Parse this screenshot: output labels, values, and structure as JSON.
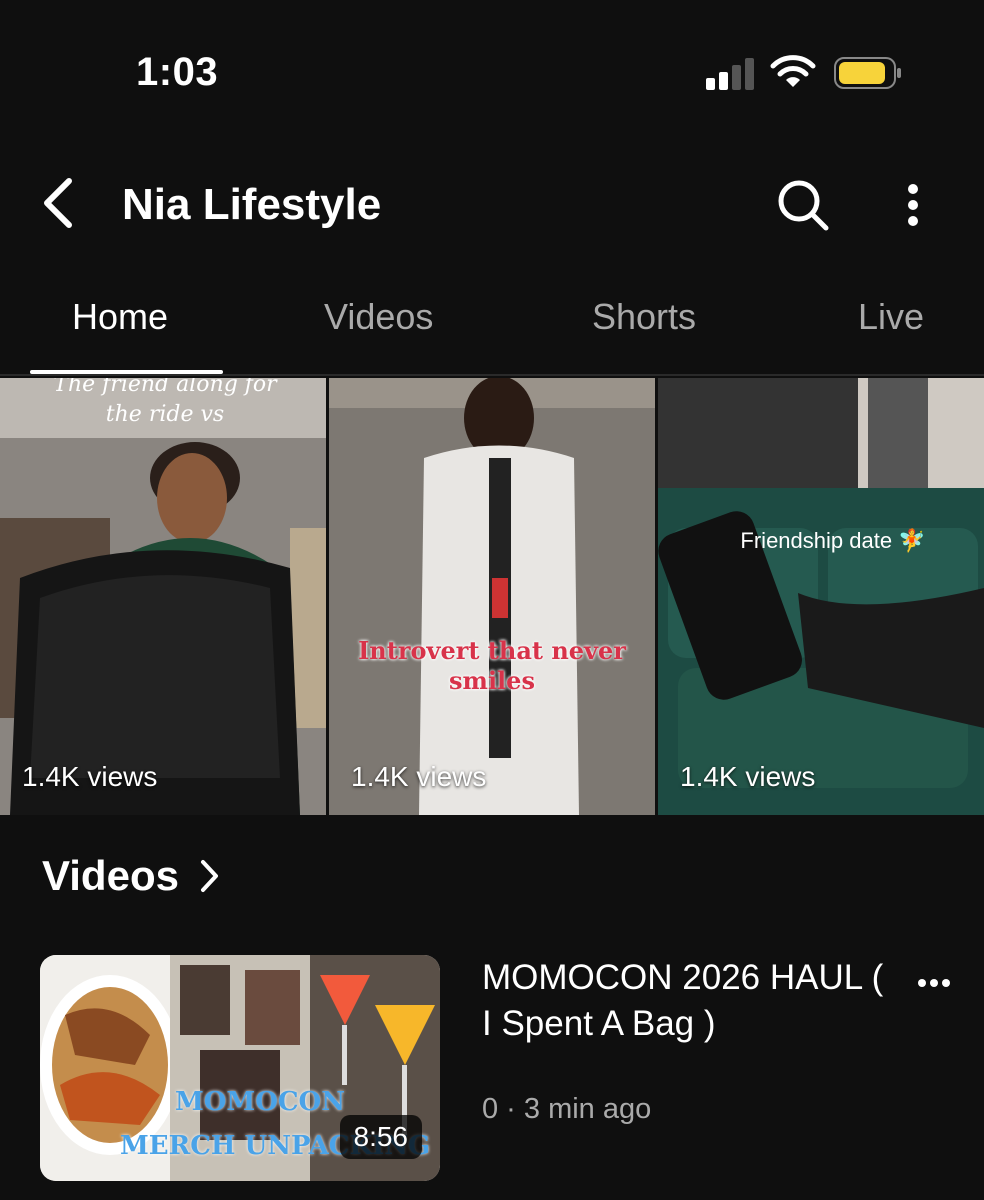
{
  "status_bar": {
    "time": "1:03"
  },
  "header": {
    "title": "Nia Lifestyle"
  },
  "tabs": [
    {
      "label": "Home",
      "active": true
    },
    {
      "label": "Videos",
      "active": false
    },
    {
      "label": "Shorts",
      "active": false
    },
    {
      "label": "Live",
      "active": false
    }
  ],
  "shorts": [
    {
      "views": "1.4K views",
      "overlay": "The friend along for the ride vs"
    },
    {
      "views": "1.4K views",
      "overlay": "Introvert that never smiles"
    },
    {
      "views": "1.4K views",
      "overlay": "Friendship date 🧚"
    }
  ],
  "videos_section": {
    "title": "Videos"
  },
  "video": {
    "title": "MOMOCON 2026 HAUL ( I Spent A Bag )",
    "meta": "0 · 3 min ago",
    "duration": "8:56",
    "thumb_text_1": "MOMOCON",
    "thumb_text_2": "MERCH UNPACKING"
  },
  "colors": {
    "background": "#0f0f0f",
    "text_primary": "#f1f1f1",
    "text_secondary": "#aaaaaa",
    "battery": "#f7d33a"
  }
}
